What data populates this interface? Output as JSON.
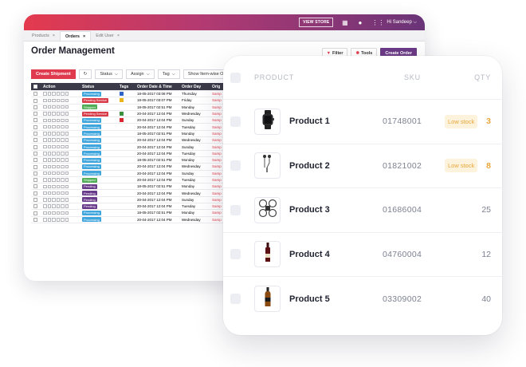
{
  "topbar": {
    "view_store": "VIEW STORE",
    "user": "Hi Sandeep"
  },
  "tabs": [
    {
      "label": "Products",
      "active": false
    },
    {
      "label": "Orders",
      "active": true
    },
    {
      "label": "Edit User",
      "active": false
    }
  ],
  "page_title": "Order Management",
  "header_buttons": {
    "filter": "Filter",
    "tools": "Tools",
    "create_order": "Create Order"
  },
  "toolbar": {
    "create_shipment": "Create Shipment",
    "status": "Status",
    "assign": "Assign",
    "tag": "Tag",
    "show_itemwise": "Show Item-wise Order"
  },
  "grid": {
    "columns": [
      "Action",
      "Status",
      "Tags",
      "Order Date & Time",
      "Order Day",
      "Orig"
    ],
    "rows": [
      {
        "status": "Processing",
        "status_color": "#3fa5dd",
        "tag": "#2d63c8",
        "date": "18-05-2017 03:08 PM",
        "day": "Thursday",
        "orig": "Samp"
      },
      {
        "status": "Pending Service",
        "status_color": "#d83a48",
        "tag": "#e9b518",
        "date": "18-05-2017 03:07 PM",
        "day": "Friday",
        "orig": "Samp"
      },
      {
        "status": "Shipped",
        "status_color": "#4fae55",
        "tag": "",
        "date": "18-05-2017 02:51 PM",
        "day": "Monday",
        "orig": "Samp"
      },
      {
        "status": "Pending Service",
        "status_color": "#d83a48",
        "tag": "#3c8f3c",
        "date": "20-04-2017 12:04 PM",
        "day": "Wednesday",
        "orig": "Samp"
      },
      {
        "status": "Processing",
        "status_color": "#3fa5dd",
        "tag": "#d8262e",
        "date": "20-04-2017 12:04 PM",
        "day": "Sunday",
        "orig": "Samp"
      },
      {
        "status": "Processing",
        "status_color": "#3fa5dd",
        "tag": "",
        "date": "20-04-2017 12:04 PM",
        "day": "Tuesday",
        "orig": "Samp"
      },
      {
        "status": "Processing",
        "status_color": "#3fa5dd",
        "tag": "",
        "date": "18-05-2017 02:51 PM",
        "day": "Monday",
        "orig": "Samp"
      },
      {
        "status": "Processing",
        "status_color": "#3fa5dd",
        "tag": "",
        "date": "20-04-2017 12:04 PM",
        "day": "Wednesday",
        "orig": "Samp"
      },
      {
        "status": "Processing",
        "status_color": "#3fa5dd",
        "tag": "",
        "date": "20-04-2017 12:04 PM",
        "day": "Sunday",
        "orig": "Samp"
      },
      {
        "status": "Processing",
        "status_color": "#3fa5dd",
        "tag": "",
        "date": "20-04-2017 12:04 PM",
        "day": "Tuesday",
        "orig": "Samp"
      },
      {
        "status": "Processing",
        "status_color": "#3fa5dd",
        "tag": "",
        "date": "18-05-2017 02:51 PM",
        "day": "Monday",
        "orig": "Samp"
      },
      {
        "status": "Processing",
        "status_color": "#3fa5dd",
        "tag": "",
        "date": "20-04-2017 12:04 PM",
        "day": "Wednesday",
        "orig": "Samp"
      },
      {
        "status": "Processing",
        "status_color": "#3fa5dd",
        "tag": "",
        "date": "20-04-2017 12:04 PM",
        "day": "Sunday",
        "orig": "Samp"
      },
      {
        "status": "Shipped",
        "status_color": "#4fae55",
        "tag": "",
        "date": "20-04-2017 12:04 PM",
        "day": "Tuesday",
        "orig": "Samp"
      },
      {
        "status": "Pending",
        "status_color": "#6a3a8a",
        "tag": "",
        "date": "18-05-2017 02:51 PM",
        "day": "Monday",
        "orig": "Samp"
      },
      {
        "status": "Pending",
        "status_color": "#6a3a8a",
        "tag": "",
        "date": "20-04-2017 12:04 PM",
        "day": "Wednesday",
        "orig": "Samp"
      },
      {
        "status": "Pending",
        "status_color": "#6a3a8a",
        "tag": "",
        "date": "20-04-2017 12:04 PM",
        "day": "Sunday",
        "orig": "Samp"
      },
      {
        "status": "Pending",
        "status_color": "#6a3a8a",
        "tag": "",
        "date": "20-04-2017 12:04 PM",
        "day": "Tuesday",
        "orig": "Samp"
      },
      {
        "status": "Processing",
        "status_color": "#3fa5dd",
        "tag": "",
        "date": "18-05-2017 02:51 PM",
        "day": "Monday",
        "orig": "Samp"
      },
      {
        "status": "Processing",
        "status_color": "#3fa5dd",
        "tag": "",
        "date": "20-04-2017 12:04 PM",
        "day": "Wednesday",
        "orig": "Samp"
      }
    ]
  },
  "products": {
    "headers": {
      "product": "PRODUCT",
      "sku": "SKU",
      "qty": "QTY"
    },
    "rows": [
      {
        "icon": "smartwatch-icon",
        "name": "Product 1",
        "sku": "01748001",
        "stock_label": "Low stock",
        "qty": "3",
        "low": true
      },
      {
        "icon": "earphones-icon",
        "name": "Product 2",
        "sku": "01821002",
        "stock_label": "Low stock",
        "qty": "8",
        "low": true
      },
      {
        "icon": "drone-icon",
        "name": "Product 3",
        "sku": "01686004",
        "stock_label": "",
        "qty": "25",
        "low": false
      },
      {
        "icon": "wine-bottle-icon",
        "name": "Product 4",
        "sku": "04760004",
        "stock_label": "",
        "qty": "12",
        "low": false
      },
      {
        "icon": "liquor-bottle-icon",
        "name": "Product 5",
        "sku": "03309002",
        "stock_label": "",
        "qty": "40",
        "low": false
      }
    ]
  },
  "colors": {
    "accent_red": "#e03a4e",
    "accent_purple": "#6b3a86",
    "low_stock": "#e8a63a"
  }
}
